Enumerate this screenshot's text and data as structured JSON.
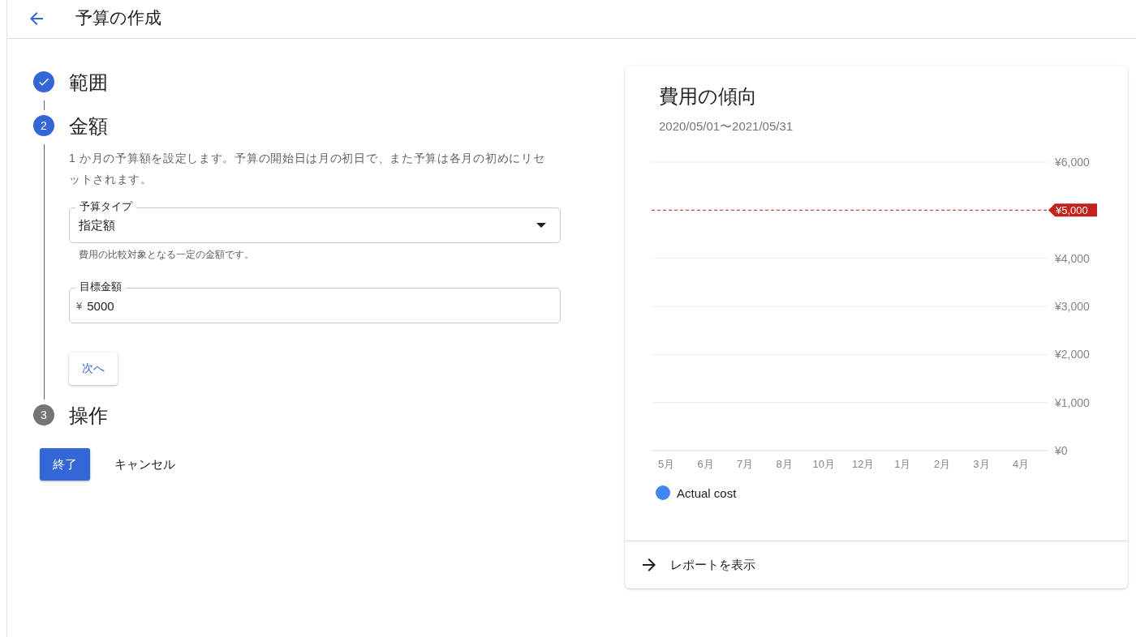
{
  "header": {
    "title": "予算の作成"
  },
  "steps": [
    {
      "kind": "done",
      "title": "範囲"
    },
    {
      "kind": "active",
      "number": "2",
      "title": "金額"
    },
    {
      "kind": "pending",
      "number": "3",
      "title": "操作"
    }
  ],
  "amount_form": {
    "description": "1 か月の予算額を設定します。予算の開始日は月の初日で、また予算は各月の初めにリセットされます。",
    "budget_type": {
      "label": "予算タイプ",
      "value": "指定額",
      "helper": "費用の比較対象となる一定の金額です。"
    },
    "target_amount": {
      "label": "目標金額",
      "prefix": "¥",
      "value": "5000"
    },
    "next_button": "次へ"
  },
  "actions": {
    "finish": "終了",
    "cancel": "キャンセル"
  },
  "trend_card": {
    "title": "費用の傾向",
    "date_range": "2020/05/01〜2021/05/31",
    "chart_data": {
      "type": "line",
      "ylim": [
        0,
        6000
      ],
      "grid": true,
      "categories": [
        "5月",
        "6月",
        "7月",
        "8月",
        "10月",
        "12月",
        "1月",
        "2月",
        "3月",
        "4月"
      ],
      "yticks": [
        {
          "value": 0,
          "label": "¥0"
        },
        {
          "value": 1000,
          "label": "¥1,000"
        },
        {
          "value": 2000,
          "label": "¥2,000"
        },
        {
          "value": 3000,
          "label": "¥3,000"
        },
        {
          "value": 4000,
          "label": "¥4,000"
        },
        {
          "value": 6000,
          "label": "¥6,000"
        }
      ],
      "series": [
        {
          "name": "Actual cost",
          "color": "#4285f4",
          "values": [
            null,
            null,
            null,
            null,
            null,
            null,
            null,
            null,
            null,
            null
          ]
        }
      ],
      "ref_lines": [
        {
          "axis": "y",
          "value": 5000,
          "label": "¥5,000",
          "color": "#c5221f"
        }
      ]
    },
    "report_link": "レポートを表示"
  }
}
